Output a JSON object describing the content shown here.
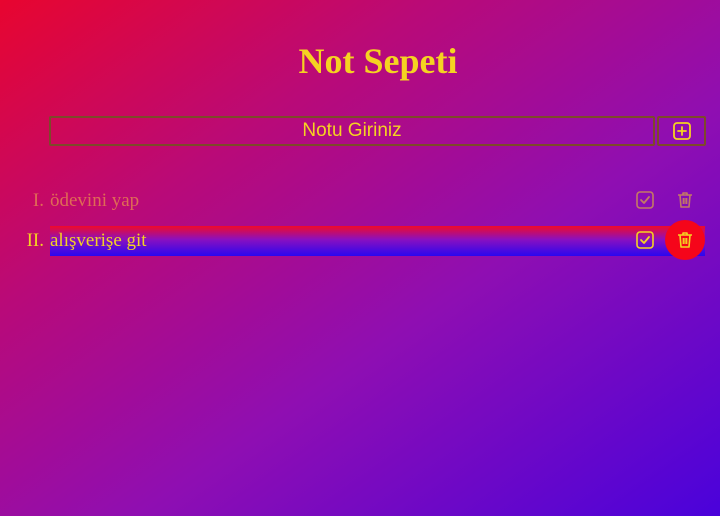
{
  "app": {
    "title": "Not Sepeti"
  },
  "input": {
    "placeholder": "Notu Giriniz",
    "value": ""
  },
  "add_button": {
    "icon": "plus-square-icon"
  },
  "todos": [
    {
      "number": "I.",
      "text": "ödevini yap",
      "state": "faded"
    },
    {
      "number": "II.",
      "text": "alışverişe git",
      "state": "hovered"
    }
  ],
  "colors": {
    "accent": "#f5d321",
    "faded_text": "#df6b55",
    "delete_active": "#f5051a",
    "bg_start": "#e8052f",
    "bg_end": "#4a02db"
  }
}
